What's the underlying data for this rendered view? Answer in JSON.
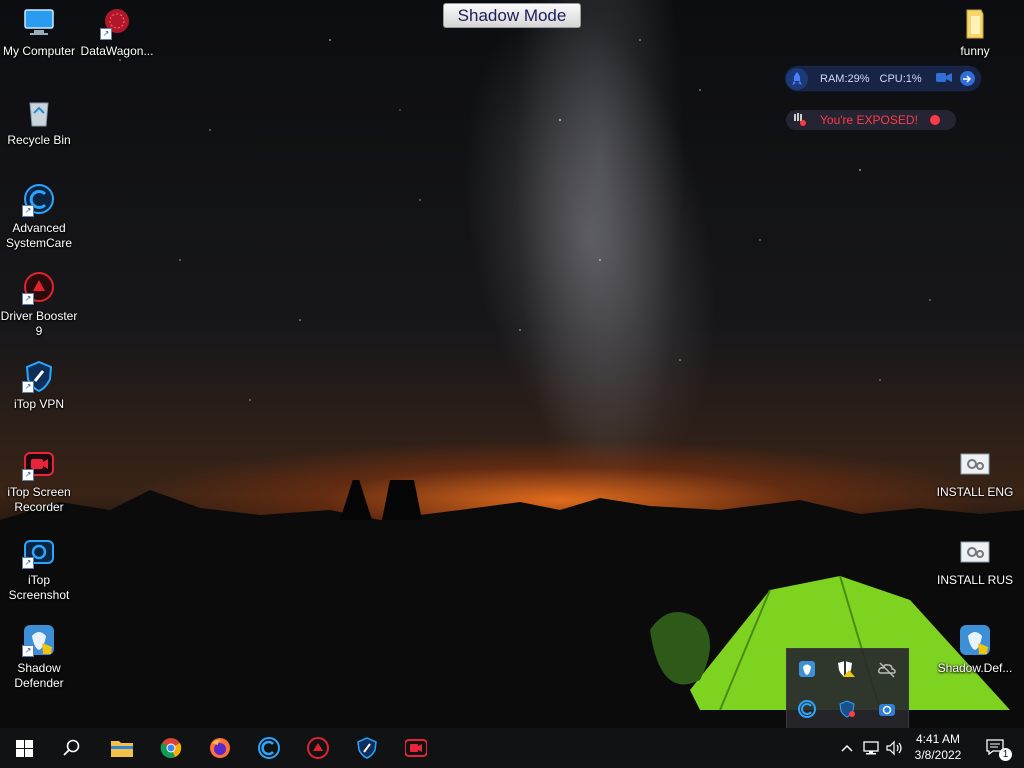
{
  "banner": {
    "label": "Shadow Mode"
  },
  "desktop_icons": [
    {
      "label": "My Computer"
    },
    {
      "label": "DataWagon..."
    },
    {
      "label": "Recycle Bin"
    },
    {
      "label": "Advanced SystemCare"
    },
    {
      "label": "Driver Booster 9"
    },
    {
      "label": "iTop VPN"
    },
    {
      "label": "iTop Screen Recorder"
    },
    {
      "label": "iTop Screenshot"
    },
    {
      "label": "Shadow Defender"
    },
    {
      "label": "funny"
    },
    {
      "label": "INSTALL ENG"
    },
    {
      "label": "INSTALL RUS"
    },
    {
      "label": "Shadow.Def..."
    }
  ],
  "system_widget": {
    "ram": "RAM:29%",
    "cpu": "CPU:1%"
  },
  "vpn_widget": {
    "status": "You're EXPOSED!"
  },
  "taskbar": {
    "apps": [
      "start-icon",
      "search-icon",
      "file-explorer-icon",
      "chrome-icon",
      "firefox-icon",
      "advanced-systemcare-icon",
      "driver-booster-icon",
      "itop-vpn-icon",
      "itop-screen-recorder-icon"
    ],
    "clock": {
      "time": "4:41 AM",
      "date": "3/8/2022"
    },
    "notification_count": "1"
  },
  "colors": {
    "taskbar": "#111214",
    "accent": "#2f6fd6",
    "exposed": "#ff3b4a"
  }
}
